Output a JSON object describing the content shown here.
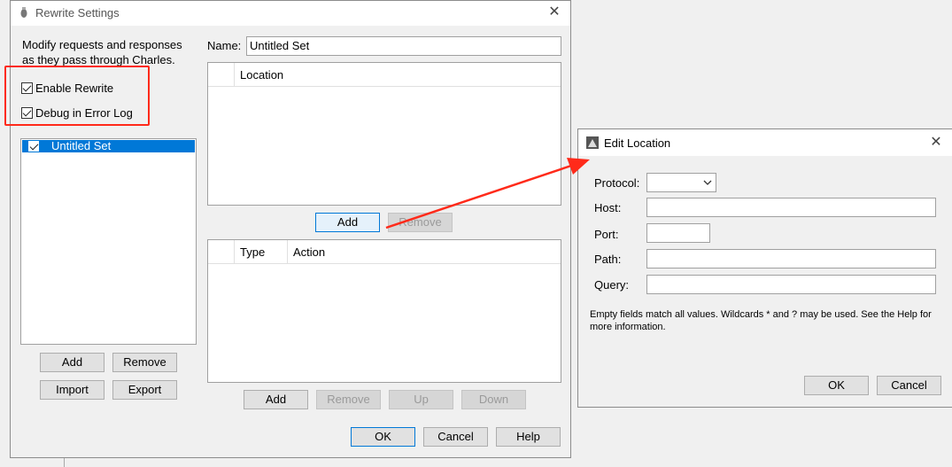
{
  "rewrite": {
    "title": "Rewrite Settings",
    "description_line1": "Modify requests and responses",
    "description_line2": "as they pass through Charles.",
    "enable_rewrite": "Enable Rewrite",
    "debug_error_log": "Debug in Error Log",
    "sets": [
      "Untitled Set"
    ],
    "name_label": "Name:",
    "name_value": "Untitled Set",
    "location_header": "Location",
    "rules_headers": {
      "type": "Type",
      "action": "Action"
    },
    "buttons": {
      "add": "Add",
      "remove": "Remove",
      "import": "Import",
      "export": "Export",
      "up": "Up",
      "down": "Down",
      "ok": "OK",
      "cancel": "Cancel",
      "help": "Help"
    }
  },
  "edit_location": {
    "title": "Edit Location",
    "protocol_label": "Protocol:",
    "protocol_value": "",
    "host_label": "Host:",
    "host_value": "",
    "port_label": "Port:",
    "port_value": "",
    "path_label": "Path:",
    "path_value": "",
    "query_label": "Query:",
    "query_value": "",
    "help_line1": "Empty fields match all values. Wildcards * and ? may be used. See the Help for",
    "help_line2": "more information.",
    "ok": "OK",
    "cancel": "Cancel"
  },
  "colors": {
    "highlight_box": "#ff2a1a",
    "arrow": "#ff2a1a",
    "selection": "#0078d7"
  }
}
